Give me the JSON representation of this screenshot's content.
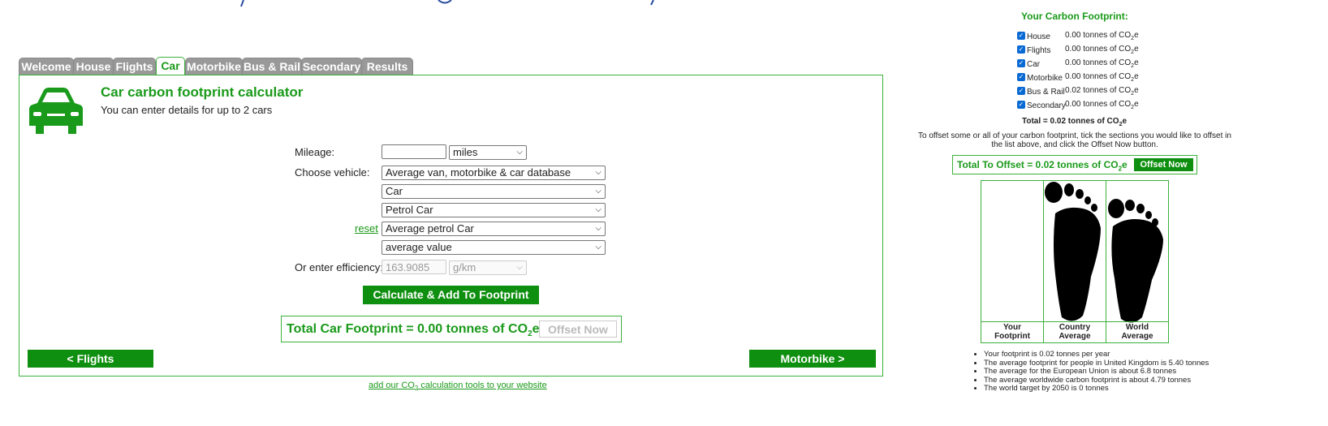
{
  "tabs": [
    "Welcome",
    "House",
    "Flights",
    "Car",
    "Motorbike",
    "Bus & Rail",
    "Secondary",
    "Results"
  ],
  "active_tab": "Car",
  "panel": {
    "title": "Car carbon footprint calculator",
    "subtitle": "You can enter details for up to 2 cars"
  },
  "form": {
    "mileage_label": "Mileage:",
    "mileage_value": "",
    "mileage_unit": "miles",
    "vehicle_label": "Choose vehicle:",
    "vehicle_db": "Average van, motorbike & car database",
    "vehicle_type": "Car",
    "fuel_type": "Petrol Car",
    "reset_label": "reset",
    "model": "Average petrol Car",
    "variant": "average value",
    "efficiency_label": "Or enter efficiency:",
    "efficiency_value": "163.9085",
    "efficiency_unit": "g/km"
  },
  "calc_button": "Calculate & Add To Footprint",
  "total_car": {
    "text": "Total Car Footprint = 0.00 tonnes of CO",
    "sub": "2",
    "suffix": "e",
    "offset_label": "Offset Now"
  },
  "nav": {
    "prev": "< Flights",
    "next": "Motorbike >"
  },
  "footer_link": {
    "pre": "add our CO",
    "sub": "2",
    "post": " calculation tools to your website"
  },
  "summary": {
    "title": "Your Carbon Footprint:",
    "rows": [
      {
        "name": "House",
        "value": "0.00 tonnes of CO",
        "sub": "2",
        "suffix": "e",
        "checked": true
      },
      {
        "name": "Flights",
        "value": "0.00 tonnes of CO",
        "sub": "2",
        "suffix": "e",
        "checked": true
      },
      {
        "name": "Car",
        "value": "0.00 tonnes of CO",
        "sub": "2",
        "suffix": "e",
        "checked": true
      },
      {
        "name": "Motorbike",
        "value": "0.00 tonnes of CO",
        "sub": "2",
        "suffix": "e",
        "checked": true
      },
      {
        "name": "Bus & Rail",
        "value": "0.02 tonnes of CO",
        "sub": "2",
        "suffix": "e",
        "checked": true
      },
      {
        "name": "Secondary",
        "value": "0.00 tonnes of CO",
        "sub": "2",
        "suffix": "e",
        "checked": true
      }
    ],
    "total": "Total = 0.02 tonnes of CO",
    "total_sub": "2",
    "total_suffix": "e",
    "note": "To offset some or all of your carbon footprint, tick the sections you would like to offset in the list above, and click the Offset Now button.",
    "offset_text": "Total To Offset = 0.02 tonnes of CO",
    "offset_sub": "2",
    "offset_suffix": "e",
    "offset_button": "Offset Now"
  },
  "footprint_chart": {
    "columns": [
      {
        "label_1": "Your",
        "label_2": "Footprint",
        "value": 0.02
      },
      {
        "label_1": "Country",
        "label_2": "Average",
        "value": 5.4
      },
      {
        "label_1": "World",
        "label_2": "Average",
        "value": 4.79
      }
    ]
  },
  "facts": [
    "Your footprint is 0.02 tonnes per year",
    "The average footprint for people in United Kingdom is 5.40 tonnes",
    "The average for the European Union is about 6.8 tonnes",
    "The average worldwide carbon footprint is about 4.79 tonnes",
    "The world target by 2050 is 0 tonnes"
  ],
  "colors": {
    "brand_green": "#1a9a1a",
    "button_green": "#0f8f0f",
    "tab_gray": "#999999",
    "banner_blue": "#2a4da0"
  }
}
